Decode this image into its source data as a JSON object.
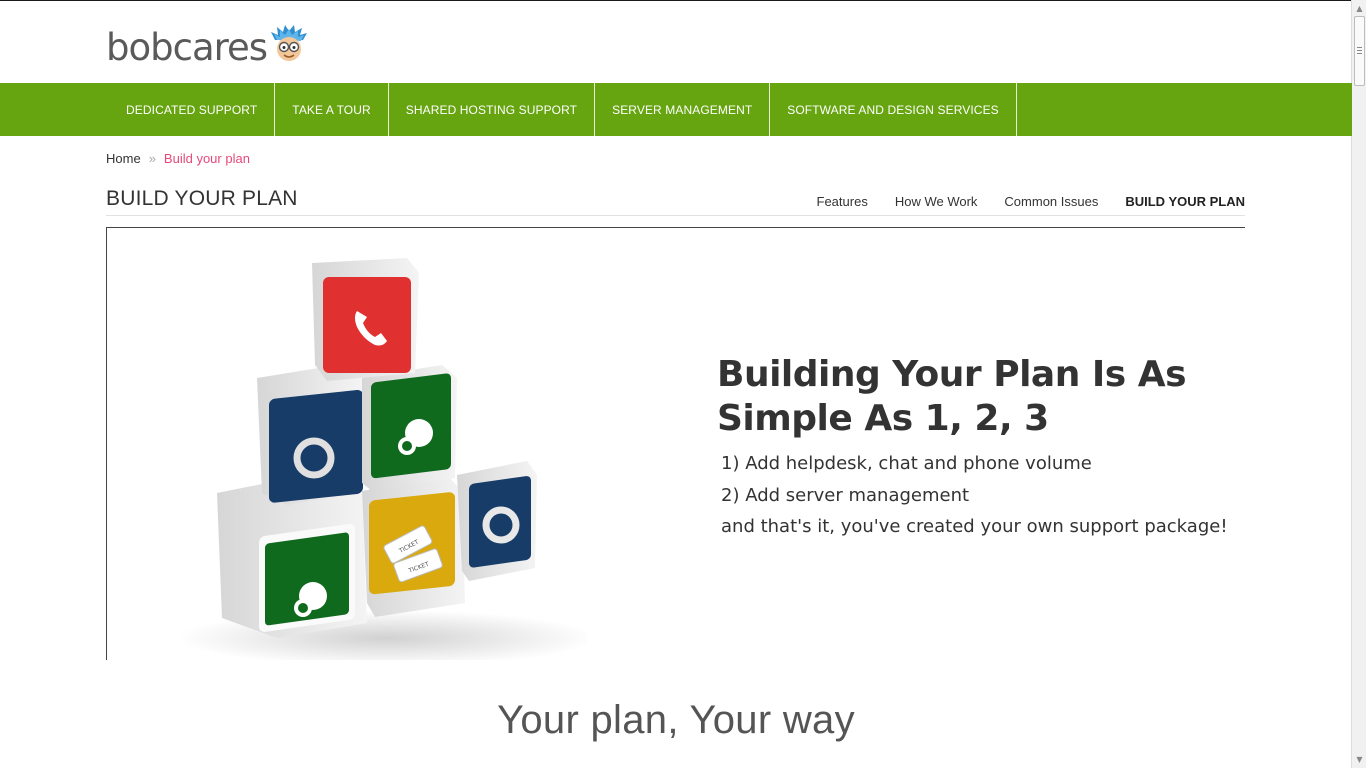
{
  "brand": {
    "name": "bobcares",
    "accent_green": "#66a410",
    "link_pink": "#e64a7a"
  },
  "nav": {
    "items": [
      {
        "label": "DEDICATED SUPPORT"
      },
      {
        "label": "TAKE A TOUR"
      },
      {
        "label": "SHARED HOSTING SUPPORT"
      },
      {
        "label": "SERVER MANAGEMENT"
      },
      {
        "label": "SOFTWARE AND DESIGN SERVICES"
      }
    ]
  },
  "breadcrumb": {
    "home": "Home",
    "separator": "»",
    "current": "Build your plan"
  },
  "page": {
    "title": "BUILD YOUR PLAN"
  },
  "subnav": {
    "items": [
      {
        "label": "Features"
      },
      {
        "label": "How We Work"
      },
      {
        "label": "Common Issues"
      },
      {
        "label": "BUILD YOUR PLAN"
      }
    ]
  },
  "hero": {
    "heading": "Building Your Plan Is As Simple As 1, 2, 3",
    "lines": [
      "1) Add helpdesk, chat and phone volume",
      "2) Add server management",
      "and that's it, you've created your own support package!"
    ],
    "ticket_text": "TICKET",
    "block_icons": [
      "phone-icon",
      "lifebuoy-icon",
      "chat-bubbles-icon",
      "chat-bubbles-icon",
      "ticket-icon",
      "lifebuoy-icon"
    ]
  },
  "section": {
    "heading": "Your plan, Your way"
  }
}
